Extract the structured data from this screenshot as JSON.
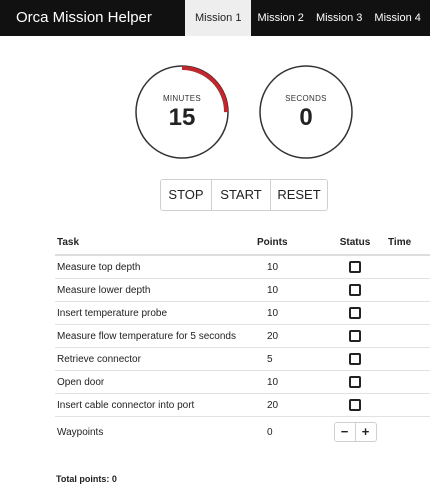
{
  "app": {
    "title": "Orca Mission Helper"
  },
  "tabs": [
    "Mission 1",
    "Mission 2",
    "Mission 3",
    "Mission 4"
  ],
  "timer": {
    "minutes_label": "MINUTES",
    "minutes_value": "15",
    "seconds_label": "SECONDS",
    "seconds_value": "0",
    "minutes_progress_fraction": 0.25,
    "progress_color": "#c0282d"
  },
  "controls": {
    "stop": "STOP",
    "start": "START",
    "reset": "RESET"
  },
  "table": {
    "headers": {
      "task": "Task",
      "points": "Points",
      "status": "Status",
      "time": "Time"
    },
    "rows": [
      {
        "task": "Measure top depth",
        "points": "10"
      },
      {
        "task": "Measure lower depth",
        "points": "10"
      },
      {
        "task": "Insert temperature probe",
        "points": "10"
      },
      {
        "task": "Measure flow temperature for 5 seconds",
        "points": "20"
      },
      {
        "task": "Retrieve connector",
        "points": "5"
      },
      {
        "task": "Open door",
        "points": "10"
      },
      {
        "task": "Insert cable connector into port",
        "points": "20"
      }
    ],
    "waypoints": {
      "task": "Waypoints",
      "points": "0",
      "minus": "−",
      "plus": "+"
    }
  },
  "total": "Total points: 0"
}
